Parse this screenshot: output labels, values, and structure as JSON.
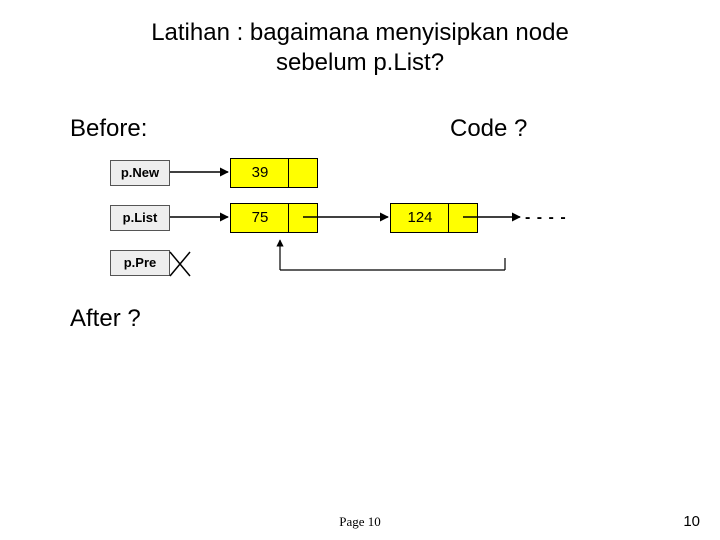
{
  "title_line1": "Latihan : bagaimana menyisipkan node",
  "title_line2": "sebelum p.List?",
  "labels": {
    "before": "Before:",
    "code": "Code ?",
    "after": "After ?"
  },
  "pointers": {
    "pnew": "p.New",
    "plist": "p.List",
    "ppre": "p.Pre"
  },
  "nodes": {
    "n39": "39",
    "n75": "75",
    "n124": "124"
  },
  "footer": {
    "page_text": "Page 10",
    "page_num": "10"
  }
}
